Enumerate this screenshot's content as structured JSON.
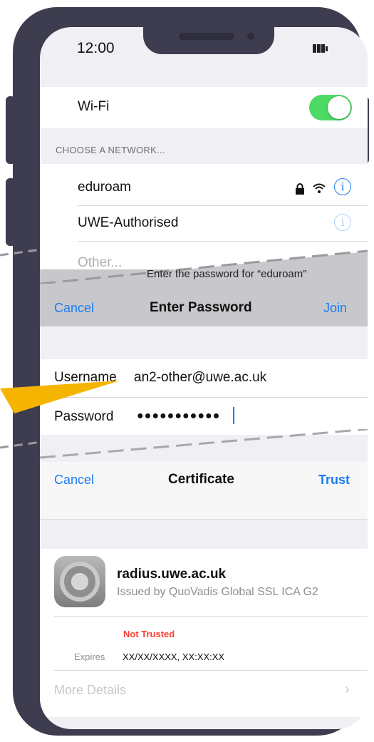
{
  "status_bar": {
    "time": "12:00"
  },
  "wifi": {
    "label": "Wi-Fi",
    "enabled": true,
    "accent_color": "#4cd964"
  },
  "networks_header": "CHOOSE A NETWORK...",
  "networks": [
    {
      "name": "eduroam",
      "secured": true,
      "info_icon": "info-icon"
    },
    {
      "name": "UWE-Authorised",
      "secured": false,
      "info_icon": "info-icon"
    },
    {
      "name": "Other..."
    }
  ],
  "password_sheet": {
    "subtitle": "Enter the password for “eduroam”",
    "cancel": "Cancel",
    "title": "Enter Password",
    "join": "Join",
    "username_label": "Username",
    "username_value": "an2-other@uwe.ac.uk",
    "password_label": "Password",
    "password_value": "●●●●●●●●●●●"
  },
  "certificate": {
    "cancel": "Cancel",
    "title": "Certificate",
    "trust": "Trust",
    "host": "radius.uwe.ac.uk",
    "issuer": "Issued by QuoVadis Global SSL ICA G2",
    "status": "Not Trusted",
    "expires_label": "Expires",
    "expires_value": "XX/XX/XXXX, XX:XX:XX",
    "more_details": "More Details"
  },
  "colors": {
    "link": "#1a7cf5",
    "warning": "#ff3b30",
    "callout": "#f5b400"
  }
}
